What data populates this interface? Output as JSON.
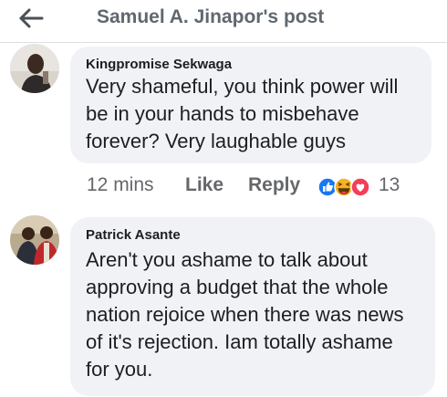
{
  "header": {
    "title": "Samuel A. Jinapor's post",
    "back_icon": "arrow-left-icon"
  },
  "comments": [
    {
      "author": "Kingpromise Sekwaga",
      "text": "Very shameful, you think power will\nbe in your hands to misbehave\nforever? Very laughable guys",
      "time": "12 mins",
      "like_label": "Like",
      "reply_label": "Reply",
      "reactions": [
        "like-reaction-icon",
        "haha-reaction-icon",
        "love-reaction-icon"
      ],
      "reaction_count": "13"
    },
    {
      "author": "Patrick Asante",
      "text": "Aren't you ashame to talk about\napproving a budget that the whole\nnation rejoice when there was news\nof it's rejection. Iam totally ashame\nfor you."
    }
  ],
  "colors": {
    "bubble": "#f0f2f5",
    "like_blue": "#1877f2",
    "haha_yellow": "#f7b125",
    "love_red": "#f33e58",
    "meta_gray": "#65676b"
  }
}
